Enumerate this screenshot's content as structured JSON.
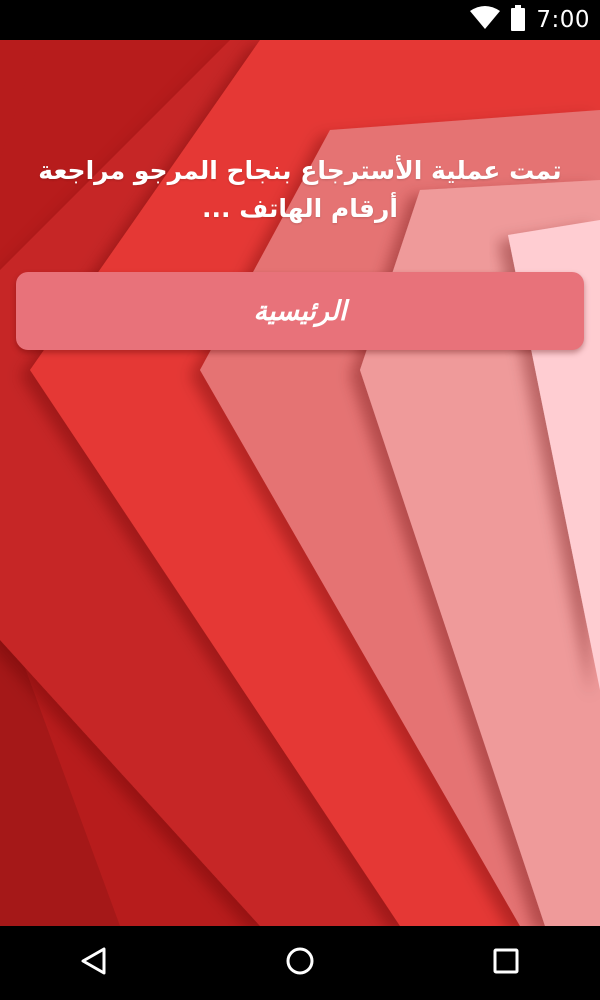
{
  "status_bar": {
    "time": "7:00",
    "icons": [
      "wifi-icon",
      "battery-icon"
    ]
  },
  "main": {
    "message": "تمت عملية الأسترجاع بنجاح المرجو مراجعة أرقام الهاتف ...",
    "home_button_label": "الرئيسية"
  },
  "nav_bar": {
    "icons": [
      "back-icon",
      "home-icon",
      "recents-icon"
    ]
  },
  "colors": {
    "background_dark": "#b71c1c",
    "background_red": "#e53935",
    "background_pink": "#e57373",
    "background_light": "#ef9a9a",
    "button": "#e8727a",
    "text": "#ffffff",
    "system_bars": "#000000"
  }
}
